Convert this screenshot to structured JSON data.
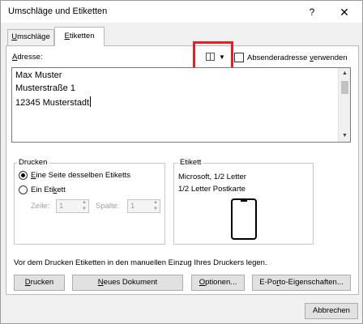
{
  "window": {
    "title": "Umschläge und Etiketten",
    "help": "?",
    "close": "✕"
  },
  "tabs": [
    {
      "label_pre": "",
      "label_u": "U",
      "label_post": "mschläge",
      "selected": false
    },
    {
      "label_pre": "",
      "label_u": "E",
      "label_post": "tiketten",
      "selected": true
    }
  ],
  "address": {
    "label_pre": "",
    "label_u": "A",
    "label_post": "dresse:",
    "lines": [
      "Max Muster",
      "Musterstraße 1",
      "12345 Musterstadt"
    ],
    "sender_checkbox": {
      "label_pre": "Absenderadresse ",
      "label_u": "v",
      "label_post": "erwenden",
      "checked": false
    }
  },
  "print_group": {
    "title": "Drucken",
    "options": [
      {
        "label_pre": "",
        "label_u": "E",
        "label_post": "ine Seite desselben Etiketts",
        "selected": true
      },
      {
        "label_pre": "Ein Eti",
        "label_u": "k",
        "label_post": "ett",
        "selected": false
      }
    ],
    "row_label": "Zeile:",
    "row_value": "1",
    "col_label": "Spalte:",
    "col_value": "1"
  },
  "label_group": {
    "title": "Etikett",
    "line1": "Microsoft, 1/2 Letter",
    "line2": "1/2 Letter Postkarte"
  },
  "note": "Vor dem Drucken Etiketten in den manuellen Einzug Ihres Druckers legen.",
  "buttons": {
    "print": {
      "pre": "",
      "u": "D",
      "post": "rucken"
    },
    "new_doc": {
      "pre": "",
      "u": "N",
      "post": "eues Dokument"
    },
    "options": {
      "pre": "",
      "u": "O",
      "post": "ptionen..."
    },
    "eporto": {
      "pre": "E-Po",
      "u": "r",
      "post": "to-Eigenschaften..."
    },
    "cancel": "Abbrechen"
  },
  "colors": {
    "highlight": "#e0202a",
    "dialog_bg": "#f0f0f0"
  }
}
